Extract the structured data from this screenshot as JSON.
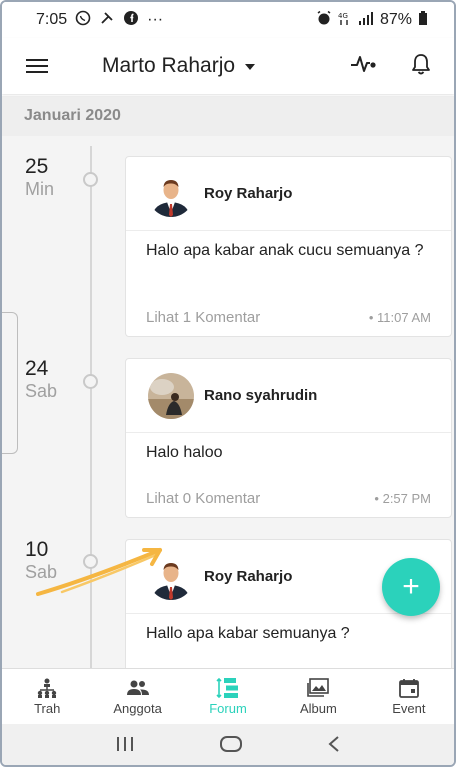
{
  "status_bar": {
    "time": "7:05",
    "left_icons": [
      "whatsapp-icon",
      "tools-icon",
      "facebook-icon"
    ],
    "more": "···",
    "right_icons": [
      "alarm-icon",
      "network-4g-icon",
      "signal-icon"
    ],
    "battery": "87%"
  },
  "app_bar": {
    "title": "Marto Raharjo",
    "icons": [
      "menu-icon",
      "activity-icon",
      "bell-icon"
    ]
  },
  "section": {
    "month": "Januari 2020"
  },
  "posts": [
    {
      "day": "25",
      "weekday": "Min",
      "author": "Roy Raharjo",
      "message": "Halo apa kabar anak cucu semuanya ?",
      "comments": "Lihat 1 Komentar",
      "time": "• 11:07 AM"
    },
    {
      "day": "24",
      "weekday": "Sab",
      "author": "Rano syahrudin",
      "message": "Halo haloo",
      "comments": "Lihat 0 Komentar",
      "time": "• 2:57 PM"
    },
    {
      "day": "10",
      "weekday": "Sab",
      "author": "Roy Raharjo",
      "message": "Hallo apa kabar semuanya ?"
    }
  ],
  "fab": {
    "label": "+"
  },
  "bottom_nav": {
    "items": [
      {
        "label": "Trah",
        "icon": "family-tree-icon"
      },
      {
        "label": "Anggota",
        "icon": "people-icon"
      },
      {
        "label": "Forum",
        "icon": "forum-icon",
        "active": true
      },
      {
        "label": "Album",
        "icon": "album-icon"
      },
      {
        "label": "Event",
        "icon": "calendar-icon"
      }
    ]
  },
  "system_nav": {
    "icons": [
      "recents-icon",
      "home-icon",
      "back-icon"
    ]
  },
  "colors": {
    "accent": "#2bd2bb",
    "annotation_arrow": "#f5b642"
  }
}
